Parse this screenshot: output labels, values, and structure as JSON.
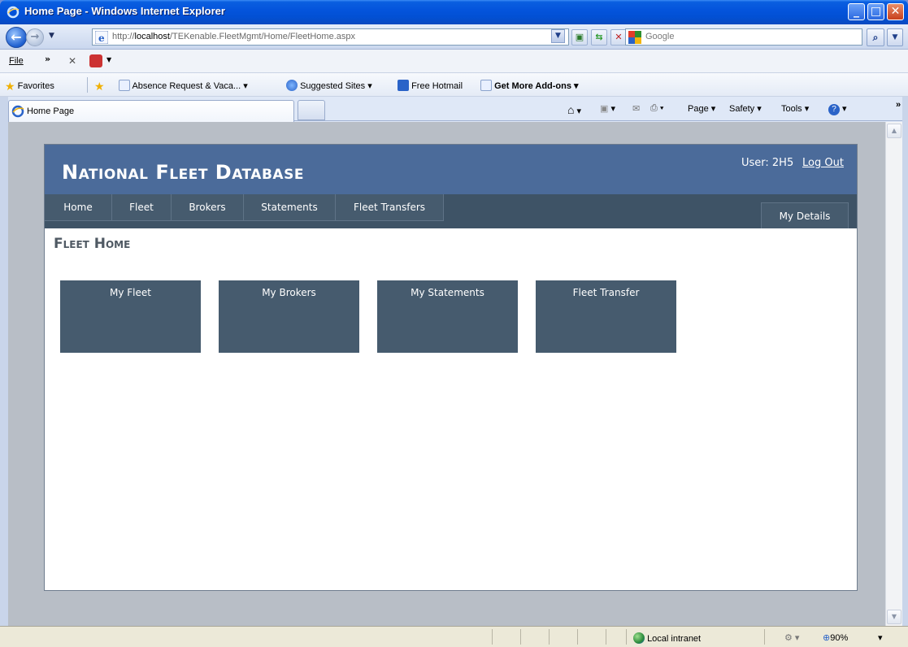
{
  "window": {
    "title": "Home Page - Windows Internet Explorer"
  },
  "address_bar": {
    "url_prefix": "http://",
    "url_host": "localhost",
    "url_path": "/TEKenable.FleetMgmt/Home/FleetHome.aspx"
  },
  "search": {
    "placeholder": "Google"
  },
  "menu": {
    "file_label": "File",
    "more_chevron": "»"
  },
  "favorites_bar": {
    "favorites_label": "Favorites",
    "items": [
      {
        "label": "Absence Request & Vaca..."
      },
      {
        "label": "Suggested Sites"
      },
      {
        "label": "Free Hotmail"
      },
      {
        "label": "Get More Add-ons"
      }
    ]
  },
  "tabs": {
    "active_tab_title": "Home Page"
  },
  "command_bar": {
    "page_label": "Page",
    "safety_label": "Safety",
    "tools_label": "Tools",
    "overflow": "»"
  },
  "site": {
    "title": "National Fleet Database",
    "user_label": "User: 2H5",
    "logout_label": "Log Out",
    "nav": [
      {
        "label": "Home"
      },
      {
        "label": "Fleet"
      },
      {
        "label": "Brokers"
      },
      {
        "label": "Statements"
      },
      {
        "label": "Fleet Transfers"
      }
    ],
    "my_details_label": "My Details",
    "page_heading": "Fleet Home",
    "tiles": [
      {
        "label": "My Fleet"
      },
      {
        "label": "My Brokers"
      },
      {
        "label": "My Statements"
      },
      {
        "label": "Fleet Transfer"
      }
    ]
  },
  "status_bar": {
    "zone": "Local intranet",
    "zoom": "90%"
  },
  "colors": {
    "header_blue": "#4b6b9a",
    "nav_slate": "#465b6e",
    "heading_gray": "#4f5963"
  }
}
